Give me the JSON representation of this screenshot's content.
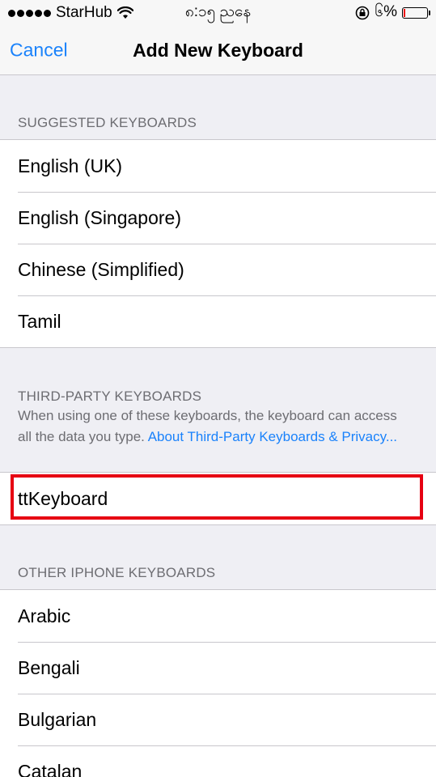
{
  "status_bar": {
    "carrier": "StarHub",
    "time": "၈:၁၅ ညနေ",
    "battery": "၆%",
    "battery_level": 0.06
  },
  "nav": {
    "cancel_label": "Cancel",
    "title": "Add New Keyboard"
  },
  "suggested": {
    "header": "SUGGESTED KEYBOARDS",
    "items": [
      "English (UK)",
      "English (Singapore)",
      "Chinese (Simplified)",
      "Tamil"
    ]
  },
  "third_party": {
    "header": "THIRD-PARTY KEYBOARDS",
    "description": "When using one of these keyboards, the keyboard can access all the data you type.",
    "link": "About Third-Party Keyboards & Privacy...",
    "items": [
      "ttKeyboard"
    ]
  },
  "other": {
    "header": "OTHER IPHONE KEYBOARDS",
    "items": [
      "Arabic",
      "Bengali",
      "Bulgarian",
      "Catalan"
    ]
  },
  "colors": {
    "accent": "#1a82fb",
    "highlight": "#e60012",
    "background": "#efeff4"
  }
}
